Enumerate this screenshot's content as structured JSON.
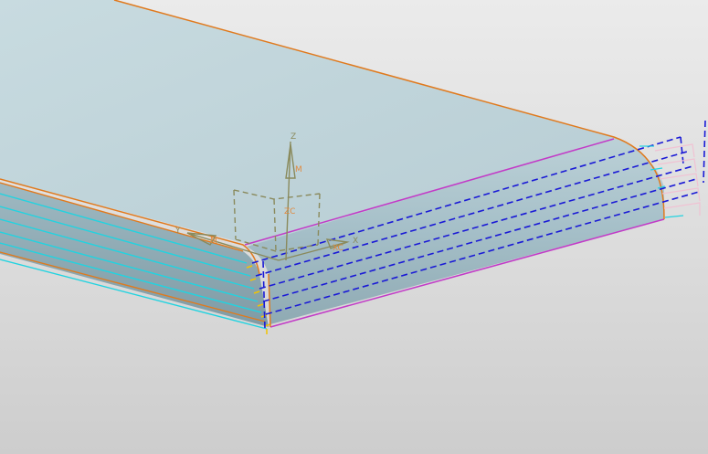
{
  "colors": {
    "face_top": "#c0d4da",
    "face_side": "#a9c3cb",
    "edge_orange": "#e07a1e",
    "edge_magenta": "#c23bc7",
    "toolpath_blue": "#1a1ad6",
    "toolpath_cyan": "#22d3e0",
    "toolpath_pink": "#f0c2d3",
    "csys": "#8a8a5c",
    "csys_label": "#e08a40",
    "tick_yellow": "#f2c400"
  },
  "csys": {
    "z_label": "Z",
    "y_label": "Y",
    "x_label": "X",
    "zc_label": "ZC",
    "m_label_z": "M",
    "m_label_y": "M",
    "xc_label": "XC"
  }
}
